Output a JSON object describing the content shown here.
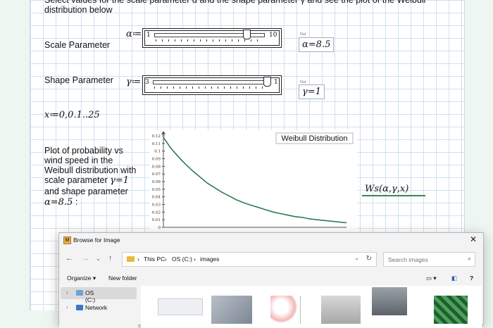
{
  "instructions": {
    "line1": "Select values for the scale parameter α and the shape parameter γ and see the plot of the Weibull",
    "line2": "distribution below"
  },
  "scale": {
    "label": "Scale Parameter",
    "symbol": "α≔",
    "min": "1",
    "max": "10",
    "value": 8.5,
    "out_label": "Out",
    "result": "α=8.5"
  },
  "shape": {
    "label": "Shape Parameter",
    "symbol": "γ≔",
    "min": "3",
    "max": "1",
    "value": 1,
    "out_label": "Out",
    "result": "γ=1"
  },
  "range_def": "x≔0,0.1..25",
  "description": {
    "line1": "Plot of probability vs",
    "line2": "wind speed in the",
    "line3": "Weibull distribution with",
    "line4a": "scale parameter ",
    "line4b": "γ=1",
    "line5": "and shape parameter",
    "line6a": "α=8.5",
    "line6b": " :"
  },
  "legend_expr": "Ws(α,γ,x)",
  "chart_data": {
    "type": "line",
    "title": "Weibull Distribution",
    "xlabel": "",
    "ylabel": "",
    "xlim": [
      0,
      25
    ],
    "ylim": [
      0,
      0.12
    ],
    "yticks": [
      "0",
      "0.01",
      "0.02",
      "0.03",
      "0.04",
      "0.05",
      "0.06",
      "0.07",
      "0.08",
      "0.09",
      "0.1",
      "0.11",
      "0.12"
    ],
    "grid": false,
    "series": [
      {
        "color": "#2e7d4f",
        "x": [
          0,
          1,
          2,
          3,
          4,
          5,
          6,
          7,
          8,
          9,
          10,
          11,
          12,
          13,
          14,
          15,
          16,
          17,
          18,
          19,
          20,
          21,
          22,
          23,
          24,
          25
        ],
        "y": [
          0.118,
          0.104,
          0.093,
          0.083,
          0.074,
          0.066,
          0.058,
          0.052,
          0.046,
          0.041,
          0.036,
          0.032,
          0.029,
          0.026,
          0.023,
          0.02,
          0.018,
          0.016,
          0.014,
          0.013,
          0.011,
          0.01,
          0.009,
          0.008,
          0.007,
          0.006
        ]
      }
    ]
  },
  "dialog": {
    "title": "Browse for Image",
    "close": "✕",
    "path": [
      "This PC",
      "OS (C:)",
      "images"
    ],
    "separators": [
      "›",
      "›",
      "›"
    ],
    "search_placeholder": "Search images",
    "organize": "Organize ▾",
    "new_folder": "New folder",
    "sidebar": [
      {
        "label": "OS (C:)"
      },
      {
        "label": "Network"
      }
    ]
  }
}
